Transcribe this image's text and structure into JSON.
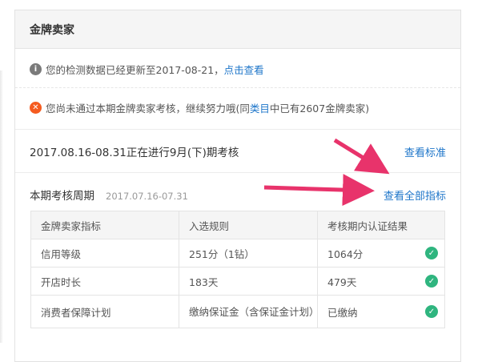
{
  "panel": {
    "title": "金牌卖家"
  },
  "info": {
    "icon": "info-icon",
    "text": "您的检测数据已经更新至2017-08-21，",
    "link": "点击查看"
  },
  "warning": {
    "icon": "error-x-icon",
    "text_before": "您尚未通过本期金牌卖家考核，继续努力哦(同",
    "link": "类目",
    "text_after": "中已有2607金牌卖家)"
  },
  "period": {
    "text": "2017.08.16-08.31正在进行9月(下)期考核",
    "link": "查看标准"
  },
  "cycle": {
    "label": "本期考核周期",
    "dates": "2017.07.16-07.31",
    "link": "查看全部指标"
  },
  "table": {
    "headers": [
      "金牌卖家指标",
      "入选规则",
      "考核期内认证结果"
    ],
    "rows": [
      {
        "metric": "信用等级",
        "rule": "251分（1钻）",
        "result": "1064分",
        "status_icon": "check-circle-icon"
      },
      {
        "metric": "开店时长",
        "rule": "183天",
        "result": "479天",
        "status_icon": "check-circle-icon"
      },
      {
        "metric": "消费者保障计划",
        "rule": "缴纳保证金（含保证金计划）",
        "result": "已缴纳",
        "status_icon": "check-circle-icon"
      }
    ]
  },
  "colors": {
    "link": "#1d75c9",
    "arrow": "#e8336b",
    "check": "#2fb57f",
    "error": "#f55b1f"
  }
}
